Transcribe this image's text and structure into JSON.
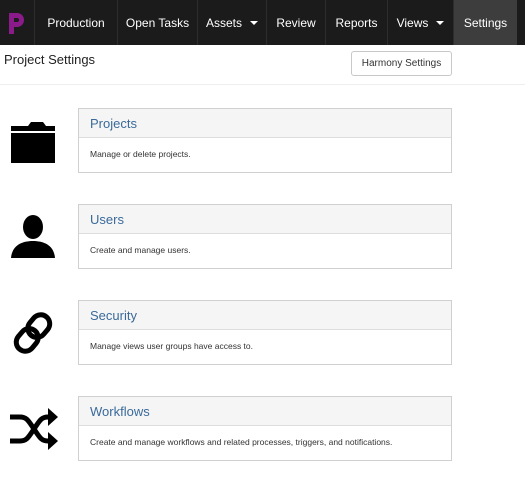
{
  "nav": {
    "items": [
      {
        "label": "Production",
        "active": false,
        "dropdown": false
      },
      {
        "label": "Open Tasks",
        "active": false,
        "dropdown": false
      },
      {
        "label": "Assets",
        "active": false,
        "dropdown": true
      },
      {
        "label": "Review",
        "active": false,
        "dropdown": false
      },
      {
        "label": "Reports",
        "active": false,
        "dropdown": false
      },
      {
        "label": "Views",
        "active": false,
        "dropdown": true
      },
      {
        "label": "Settings",
        "active": true,
        "dropdown": false
      }
    ]
  },
  "page": {
    "title": "Project Settings",
    "harmony_button": "Harmony Settings"
  },
  "sections": [
    {
      "icon": "folder-icon",
      "title": "Projects",
      "description": "Manage or delete projects."
    },
    {
      "icon": "user-icon",
      "title": "Users",
      "description": "Create and manage users."
    },
    {
      "icon": "link-icon",
      "title": "Security",
      "description": "Manage views user groups have access to."
    },
    {
      "icon": "shuffle-icon",
      "title": "Workflows",
      "description": "Create and manage workflows and related processes, triggers, and notifications."
    }
  ],
  "colors": {
    "nav_bg": "#1b1b1b",
    "nav_active": "#3d3d3d",
    "logo": "#8b1a8b",
    "link": "#3a6a9a"
  }
}
